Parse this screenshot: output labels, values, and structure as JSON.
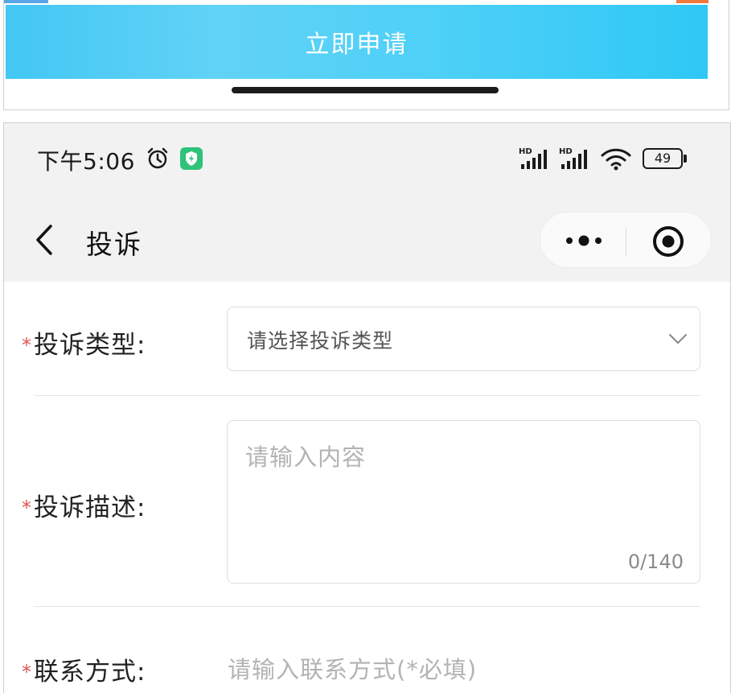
{
  "top_screen": {
    "apply_button_label": "立即申请"
  },
  "status_bar": {
    "time": "下午5:06",
    "battery": "49",
    "signal1_label": "HD",
    "signal2_label": "HD"
  },
  "nav": {
    "title": "投诉"
  },
  "form": {
    "required_mark": "*",
    "type": {
      "label": "投诉类型:",
      "placeholder": "请选择投诉类型"
    },
    "description": {
      "label": "投诉描述:",
      "placeholder": "请输入内容",
      "counter": "0/140"
    },
    "contact": {
      "label": "联系方式:",
      "placeholder": "请输入联系方式(*必填)"
    }
  },
  "colors": {
    "accent": "#43c7f4",
    "required": "#e25454",
    "badge_green": "#2fc27a"
  },
  "icons": [
    "alarm-icon",
    "shield-badge-icon",
    "signal-icon",
    "wifi-icon",
    "battery-icon",
    "back-icon",
    "more-icon",
    "target-icon",
    "chevron-down-icon"
  ]
}
